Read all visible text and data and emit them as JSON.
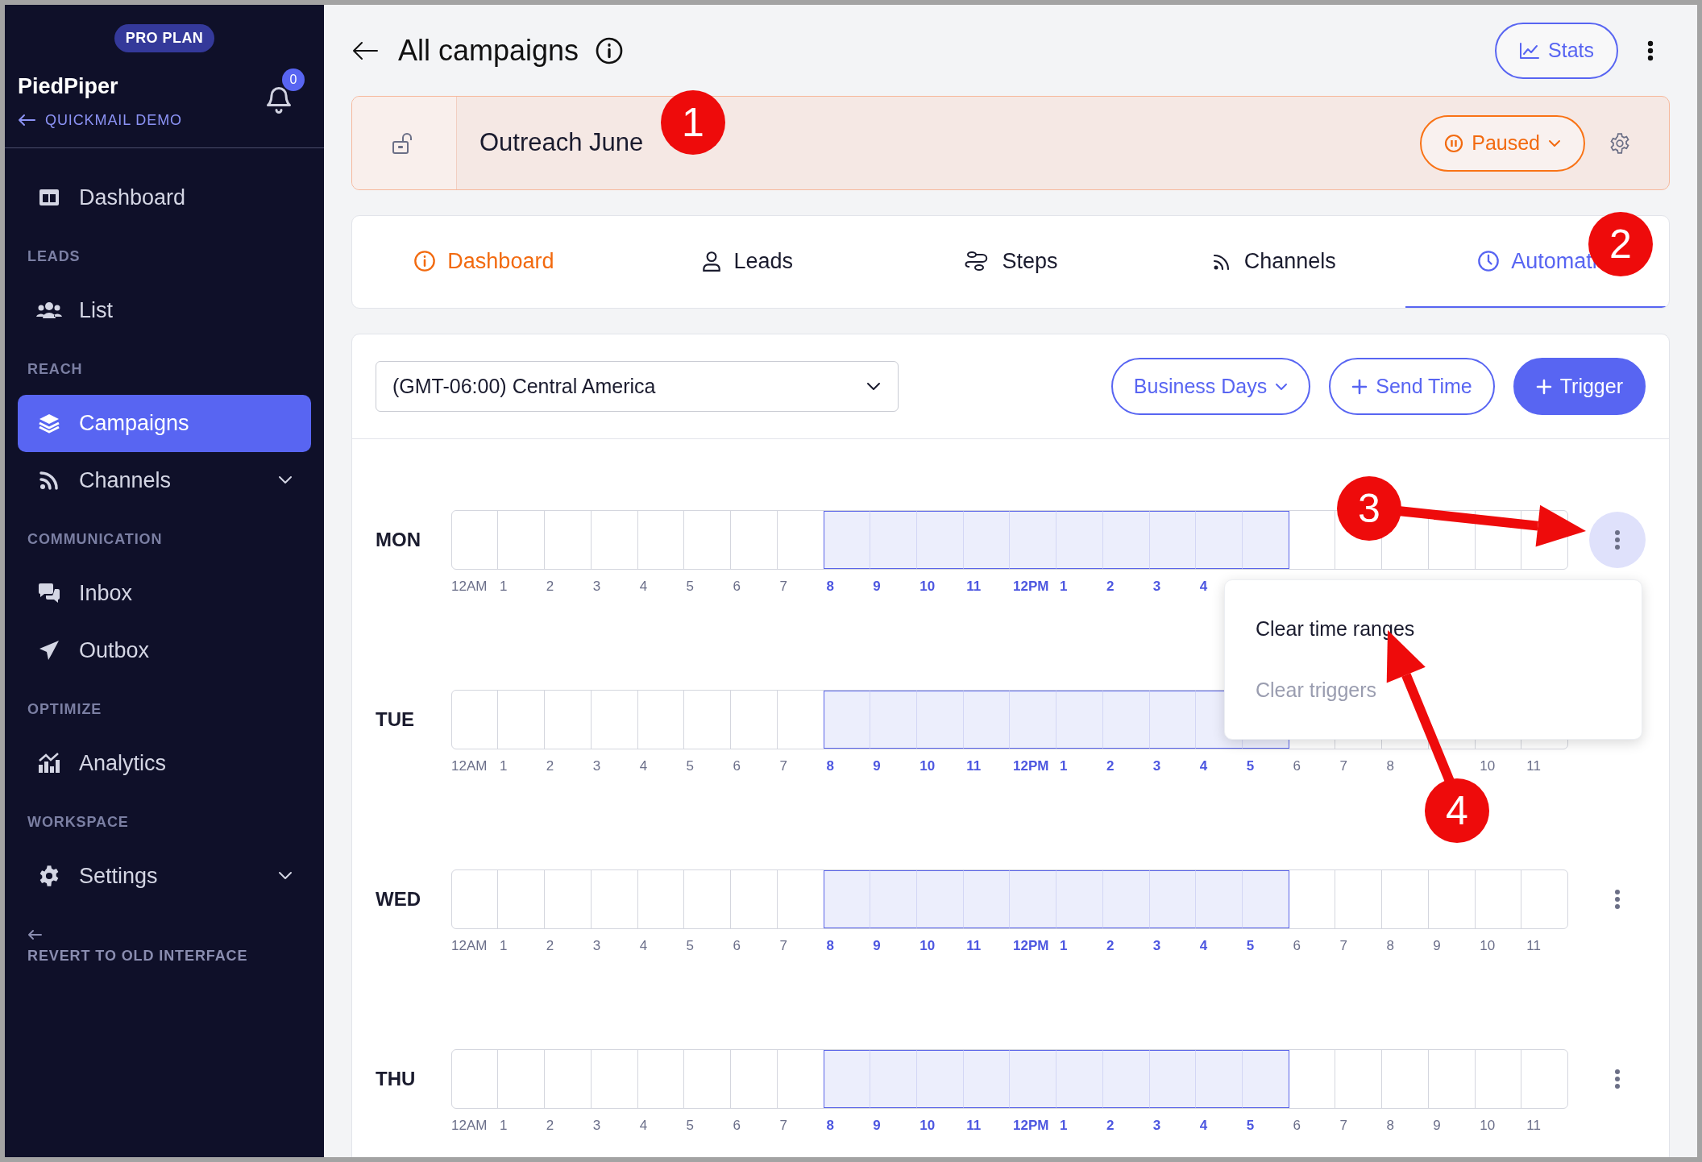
{
  "sidebar": {
    "plan_badge": "PRO PLAN",
    "workspace": "PiedPiper",
    "back_link": "QUICKMAIL DEMO",
    "notification_count": "0",
    "items": [
      {
        "kind": "link",
        "label": "Dashboard",
        "selected": false,
        "expandable": false
      },
      {
        "kind": "section",
        "label": "LEADS"
      },
      {
        "kind": "link",
        "label": "List",
        "selected": false,
        "expandable": false
      },
      {
        "kind": "section",
        "label": "REACH"
      },
      {
        "kind": "link",
        "label": "Campaigns",
        "selected": true,
        "expandable": false
      },
      {
        "kind": "link",
        "label": "Channels",
        "selected": false,
        "expandable": true
      },
      {
        "kind": "section",
        "label": "COMMUNICATION"
      },
      {
        "kind": "link",
        "label": "Inbox",
        "selected": false,
        "expandable": false
      },
      {
        "kind": "link",
        "label": "Outbox",
        "selected": false,
        "expandable": false
      },
      {
        "kind": "section",
        "label": "OPTIMIZE"
      },
      {
        "kind": "link",
        "label": "Analytics",
        "selected": false,
        "expandable": false
      },
      {
        "kind": "section",
        "label": "WORKSPACE"
      },
      {
        "kind": "link",
        "label": "Settings",
        "selected": false,
        "expandable": true
      }
    ],
    "footer_link": "REVERT TO OLD INTERFACE"
  },
  "header": {
    "title": "All campaigns",
    "stats_button": "Stats"
  },
  "campaign": {
    "name": "Outreach June",
    "status": "Paused"
  },
  "tabs": [
    {
      "label": "Dashboard",
      "selected": false,
      "warning": true
    },
    {
      "label": "Leads",
      "selected": false,
      "warning": false
    },
    {
      "label": "Steps",
      "selected": false,
      "warning": false
    },
    {
      "label": "Channels",
      "selected": false,
      "warning": false
    },
    {
      "label": "Automati",
      "selected": true,
      "warning": false
    }
  ],
  "toolbar": {
    "timezone": "(GMT-06:00) Central America",
    "buttons": [
      {
        "kind": "dropdown",
        "label": "Business Days"
      },
      {
        "kind": "add",
        "label": "Send Time"
      },
      {
        "kind": "primary",
        "label": "Trigger"
      }
    ]
  },
  "days": [
    {
      "day": "MON",
      "menu_open": true,
      "hours": [
        {
          "label": "12AM",
          "active": false
        },
        {
          "label": "1",
          "active": false
        },
        {
          "label": "2",
          "active": false
        },
        {
          "label": "3",
          "active": false
        },
        {
          "label": "4",
          "active": false
        },
        {
          "label": "5",
          "active": false
        },
        {
          "label": "6",
          "active": false
        },
        {
          "label": "7",
          "active": false
        },
        {
          "label": "8",
          "active": true
        },
        {
          "label": "9",
          "active": true
        },
        {
          "label": "10",
          "active": true
        },
        {
          "label": "11",
          "active": true
        },
        {
          "label": "12PM",
          "active": true
        },
        {
          "label": "1",
          "active": true
        },
        {
          "label": "2",
          "active": true
        },
        {
          "label": "3",
          "active": true
        },
        {
          "label": "4",
          "active": true
        },
        {
          "active": true
        },
        {
          "active": false
        },
        {
          "active": false
        },
        {
          "active": false
        },
        {
          "active": false
        },
        {
          "active": false
        },
        {
          "active": false
        }
      ]
    },
    {
      "day": "TUE",
      "menu_open": false,
      "hours": [
        {
          "label": "12AM",
          "active": false
        },
        {
          "label": "1",
          "active": false
        },
        {
          "label": "2",
          "active": false
        },
        {
          "label": "3",
          "active": false
        },
        {
          "label": "4",
          "active": false
        },
        {
          "label": "5",
          "active": false
        },
        {
          "label": "6",
          "active": false
        },
        {
          "label": "7",
          "active": false
        },
        {
          "label": "8",
          "active": true
        },
        {
          "label": "9",
          "active": true
        },
        {
          "label": "10",
          "active": true
        },
        {
          "label": "11",
          "active": true
        },
        {
          "label": "12PM",
          "active": true
        },
        {
          "label": "1",
          "active": true
        },
        {
          "label": "2",
          "active": true
        },
        {
          "label": "3",
          "active": true
        },
        {
          "label": "4",
          "active": true
        },
        {
          "label": "5",
          "active": true
        },
        {
          "label": "6",
          "active": false
        },
        {
          "label": "7",
          "active": false
        },
        {
          "label": "8",
          "active": false
        },
        {
          "active": false
        },
        {
          "label": "10",
          "active": false
        },
        {
          "label": "11",
          "active": false
        }
      ]
    },
    {
      "day": "WED",
      "menu_open": false,
      "hours": [
        {
          "label": "12AM",
          "active": false
        },
        {
          "label": "1",
          "active": false
        },
        {
          "label": "2",
          "active": false
        },
        {
          "label": "3",
          "active": false
        },
        {
          "label": "4",
          "active": false
        },
        {
          "label": "5",
          "active": false
        },
        {
          "label": "6",
          "active": false
        },
        {
          "label": "7",
          "active": false
        },
        {
          "label": "8",
          "active": true
        },
        {
          "label": "9",
          "active": true
        },
        {
          "label": "10",
          "active": true
        },
        {
          "label": "11",
          "active": true
        },
        {
          "label": "12PM",
          "active": true
        },
        {
          "label": "1",
          "active": true
        },
        {
          "label": "2",
          "active": true
        },
        {
          "label": "3",
          "active": true
        },
        {
          "label": "4",
          "active": true
        },
        {
          "label": "5",
          "active": true
        },
        {
          "label": "6",
          "active": false
        },
        {
          "label": "7",
          "active": false
        },
        {
          "label": "8",
          "active": false
        },
        {
          "label": "9",
          "active": false
        },
        {
          "label": "10",
          "active": false
        },
        {
          "label": "11",
          "active": false
        }
      ]
    },
    {
      "day": "THU",
      "menu_open": false,
      "hours": [
        {
          "label": "12AM",
          "active": false
        },
        {
          "label": "1",
          "active": false
        },
        {
          "label": "2",
          "active": false
        },
        {
          "label": "3",
          "active": false
        },
        {
          "label": "4",
          "active": false
        },
        {
          "label": "5",
          "active": false
        },
        {
          "label": "6",
          "active": false
        },
        {
          "label": "7",
          "active": false
        },
        {
          "label": "8",
          "active": true
        },
        {
          "label": "9",
          "active": true
        },
        {
          "label": "10",
          "active": true
        },
        {
          "label": "11",
          "active": true
        },
        {
          "label": "12PM",
          "active": true
        },
        {
          "label": "1",
          "active": true
        },
        {
          "label": "2",
          "active": true
        },
        {
          "label": "3",
          "active": true
        },
        {
          "label": "4",
          "active": true
        },
        {
          "label": "5",
          "active": true
        },
        {
          "label": "6",
          "active": false
        },
        {
          "label": "7",
          "active": false
        },
        {
          "label": "8",
          "active": false
        },
        {
          "label": "9",
          "active": false
        },
        {
          "label": "10",
          "active": false
        },
        {
          "label": "11",
          "active": false
        }
      ]
    }
  ],
  "day_menu": [
    {
      "label": "Clear time ranges",
      "disabled": false
    },
    {
      "label": "Clear triggers",
      "disabled": true
    }
  ],
  "callouts": [
    {
      "number": "1",
      "arrow": false
    },
    {
      "number": "2",
      "arrow": false
    },
    {
      "number": "3",
      "arrow": true
    },
    {
      "number": "4",
      "arrow": true
    }
  ]
}
